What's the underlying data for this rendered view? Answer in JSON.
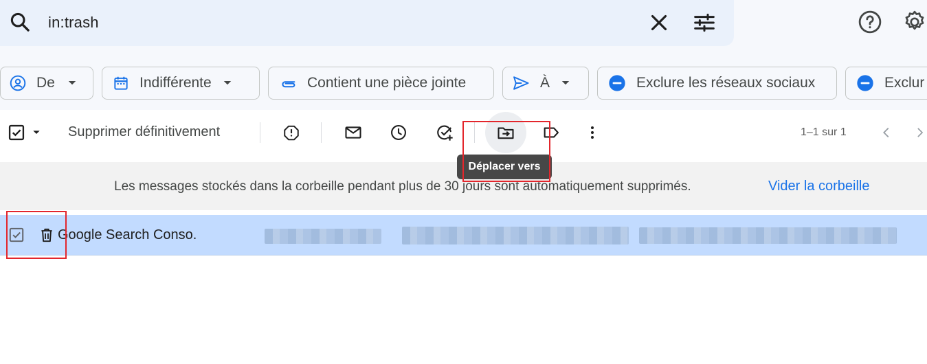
{
  "search": {
    "query": "in:trash"
  },
  "chips": [
    {
      "label": "De",
      "icon": "person-circle-icon",
      "dropdown": true
    },
    {
      "label": "Indifférente",
      "icon": "calendar-icon",
      "dropdown": true
    },
    {
      "label": "Contient une pièce jointe",
      "icon": "paperclip-icon",
      "dropdown": false
    },
    {
      "label": "À",
      "icon": "send-icon",
      "dropdown": true
    },
    {
      "label": "Exclure les réseaux sociaux",
      "icon": "minus-circle-icon",
      "dropdown": false
    },
    {
      "label": "Exclur",
      "icon": "minus-circle-icon",
      "dropdown": false
    }
  ],
  "toolbar": {
    "delete_forever_label": "Supprimer définitivement",
    "pagination": "1–1 sur 1"
  },
  "tooltip": {
    "text": "Déplacer vers"
  },
  "banner": {
    "text": "Les messages stockés dans la corbeille pendant plus de 30 jours sont automatiquement supprimés.",
    "link": "Vider la corbeille"
  },
  "messages": [
    {
      "sender": "Google Search Conso.",
      "selected": true
    }
  ],
  "colors": {
    "accent": "#1a73e8",
    "selected_row": "#c2dbff",
    "search_bg": "#eaf1fb",
    "annotation": "#e3262c"
  }
}
